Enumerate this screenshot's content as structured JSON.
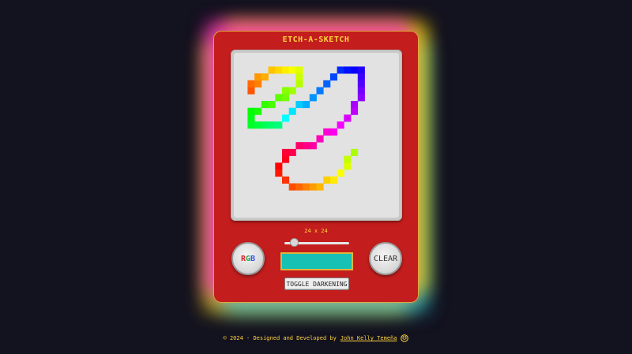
{
  "app": {
    "title": "ETCH-A-SKETCH"
  },
  "canvas": {
    "grid_size_label": "24 x 24",
    "background": "#e2e2e2",
    "drawing_description_colors": "rainbow"
  },
  "controls": {
    "rgb_button": {
      "r": "R",
      "g": "G",
      "b": "B"
    },
    "clear_button": "CLEAR",
    "toggle_button": "TOGGLE DARKENING",
    "current_color": "#17c1b4",
    "slider_value_fraction": 0.12
  },
  "footer": {
    "prefix": "© 2024 - Designed and Developed by",
    "author": "John Kelly Temeña"
  },
  "colors": {
    "frame": "#c31d1d",
    "accent": "#ffd33d",
    "page_bg": "#13121f"
  },
  "icons": {
    "footer_logo": "github-cat-icon"
  }
}
